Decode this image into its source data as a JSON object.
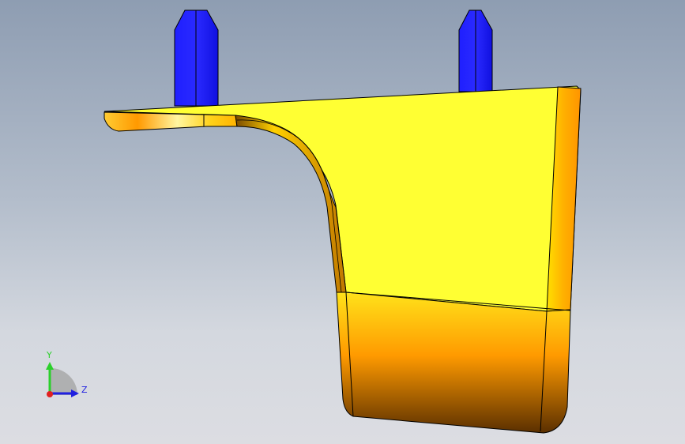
{
  "viewport": {
    "background_top": "#8e9db2",
    "background_bottom": "#dcdde2"
  },
  "part": {
    "face_color": "#ffff33",
    "edge_color": "#1a1a00",
    "pin_color": "#1a1aff"
  },
  "triad": {
    "y_label": "Y",
    "z_label": "Z",
    "y_color": "#2bd02b",
    "z_color": "#2020e0",
    "x_color": "#e02020"
  }
}
